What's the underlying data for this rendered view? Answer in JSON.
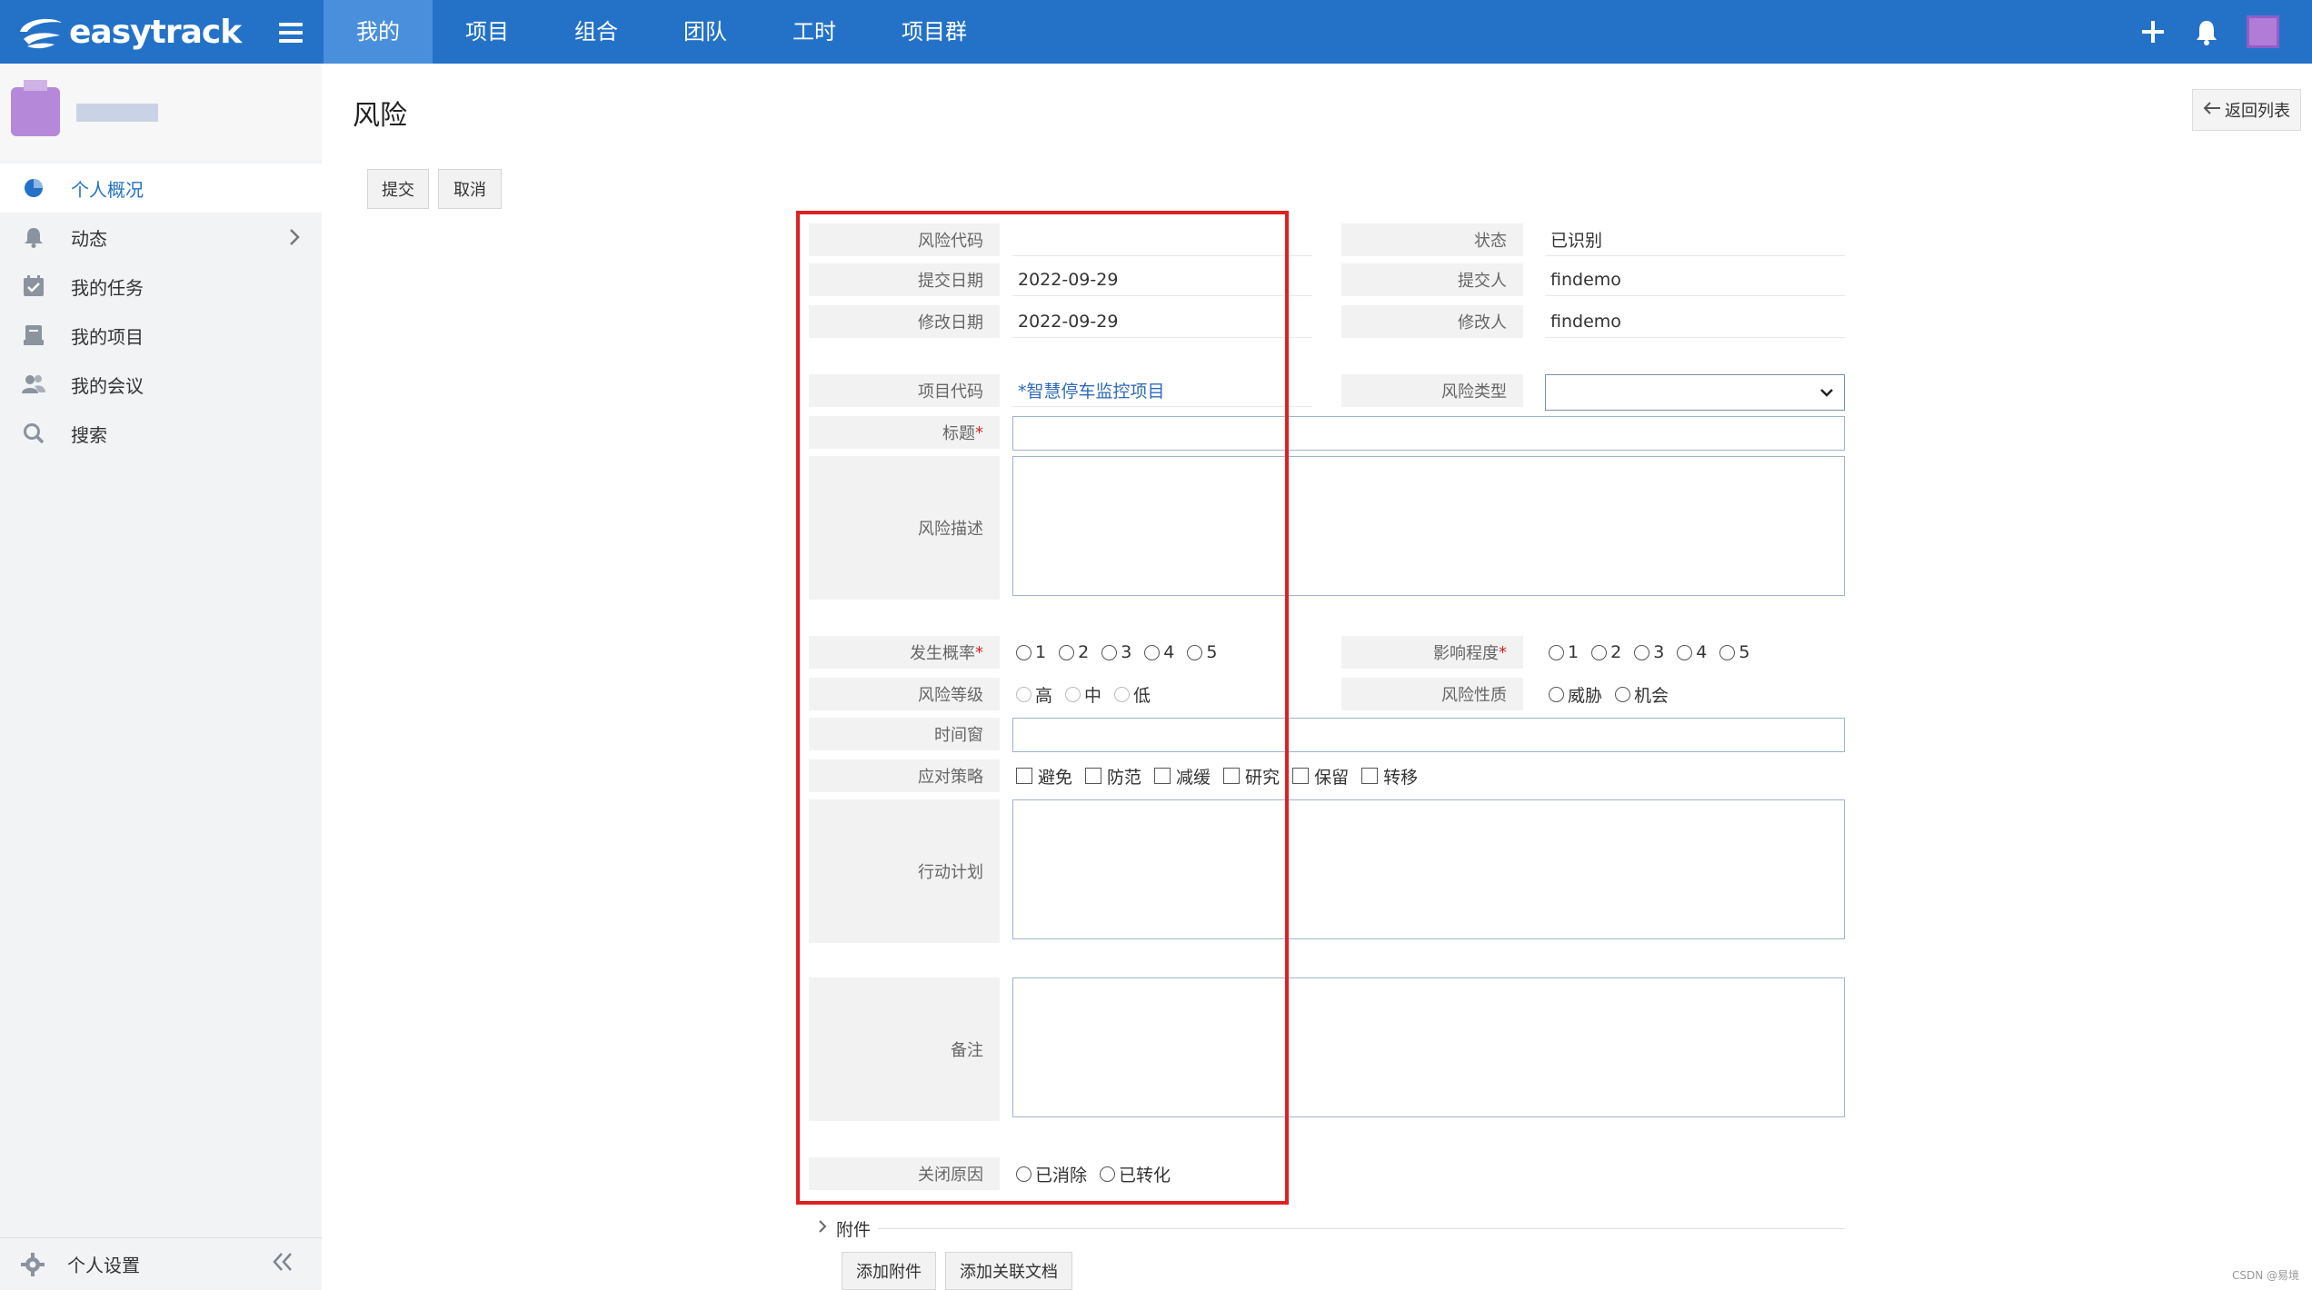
{
  "app": {
    "logo_text": "easytrack"
  },
  "nav": {
    "tabs": [
      "我的",
      "项目",
      "组合",
      "团队",
      "工时",
      "项目群"
    ],
    "active_index": 0
  },
  "sidebar": {
    "items": [
      {
        "label": "个人概况",
        "icon": "pie-chart-icon",
        "active": true
      },
      {
        "label": "动态",
        "icon": "bell-icon",
        "has_submenu": true
      },
      {
        "label": "我的任务",
        "icon": "calendar-check-icon"
      },
      {
        "label": "我的项目",
        "icon": "project-icon"
      },
      {
        "label": "我的会议",
        "icon": "users-icon"
      },
      {
        "label": "搜索",
        "icon": "search-icon"
      }
    ],
    "settings_label": "个人设置"
  },
  "page": {
    "title": "风险",
    "back_label": "返回列表"
  },
  "toolbar": {
    "submit_label": "提交",
    "cancel_label": "取消"
  },
  "form": {
    "risk_code": {
      "label": "风险代码",
      "value": ""
    },
    "status": {
      "label": "状态",
      "value": "已识别"
    },
    "submit_date": {
      "label": "提交日期",
      "value": "2022-09-29"
    },
    "submitter": {
      "label": "提交人",
      "value": "findemo"
    },
    "modify_date": {
      "label": "修改日期",
      "value": "2022-09-29"
    },
    "modifier": {
      "label": "修改人",
      "value": "findemo"
    },
    "project_code": {
      "label": "项目代码",
      "value": "*智慧停车监控项目"
    },
    "risk_type": {
      "label": "风险类型",
      "value": ""
    },
    "title": {
      "label": "标题",
      "required_mark": "*"
    },
    "description": {
      "label": "风险描述"
    },
    "probability": {
      "label": "发生概率",
      "required_mark": "*",
      "options": [
        "1",
        "2",
        "3",
        "4",
        "5"
      ]
    },
    "impact": {
      "label": "影响程度",
      "required_mark": "*",
      "options": [
        "1",
        "2",
        "3",
        "4",
        "5"
      ]
    },
    "level": {
      "label": "风险等级",
      "options": [
        "高",
        "中",
        "低"
      ]
    },
    "nature": {
      "label": "风险性质",
      "options": [
        "威胁",
        "机会"
      ]
    },
    "time_window": {
      "label": "时间窗"
    },
    "strategy": {
      "label": "应对策略",
      "options": [
        "避免",
        "防范",
        "减缓",
        "研究",
        "保留",
        "转移"
      ]
    },
    "action_plan": {
      "label": "行动计划"
    },
    "remarks": {
      "label": "备注"
    },
    "close_reason": {
      "label": "关闭原因",
      "options": [
        "已消除",
        "已转化"
      ]
    }
  },
  "attachments": {
    "section_label": "附件",
    "add_attachment_label": "添加附件",
    "add_doc_label": "添加关联文档"
  },
  "watermark": "CSDN @易境",
  "colors": {
    "brand": "#2472c8",
    "highlight_box": "#e02020"
  }
}
